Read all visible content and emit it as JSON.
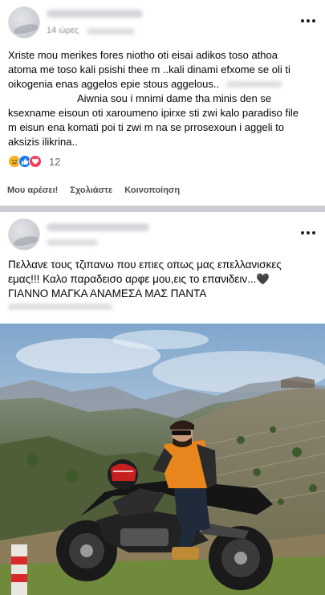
{
  "post1": {
    "time_text": "14 ώρες",
    "body_lines": [
      "Xriste mou merikes fores niotho oti eisai adikos toso athoa",
      "atoma me toso kali psishi thee m ..kali dinami efxome se oli ti",
      "oikogenia enas aggelos epie stous aggelous..",
      "Aiwnia sou i mnimi dame tha minis den se",
      "ksexname eisoun oti xaroumeno ipirxe sti zwi kalo paradiso file",
      "m eisun ena komati poi ti zwi m na se prrosexoun i aggeli to",
      "aksizis ilikrina.."
    ],
    "reaction_count": "12",
    "reactions": [
      "sad",
      "like",
      "love"
    ],
    "actions": {
      "like": "Μου αρέσει!",
      "comment": "Σχολιάστε",
      "share": "Κοινοποίηση"
    }
  },
  "post2": {
    "body_lines": [
      "Πελλανε τους τζιπανω που επιες οπως μας επελλανισκες",
      "εμας!!! Καλο παραδεισο αρφε μου,εις το επανιδειν...🖤",
      "ΓΙΑΝΝΟ ΜΑΓΚΑ ΑΝΑΜΕΣΑ ΜΑΣ ΠΑΝΤΑ"
    ]
  },
  "colors": {
    "separator": "#c9ccd1",
    "secondary_text": "#65676b",
    "like_blue": "#1877f2",
    "love_red": "#f33e58",
    "sad_yellow": "#f7b125",
    "sky_top": "#7fa6cc",
    "jacket_orange": "#e8851d"
  },
  "icons": {
    "more": "more-options-icon",
    "reaction_sad": "sad-reaction-icon",
    "reaction_like": "like-reaction-icon",
    "reaction_love": "love-reaction-icon",
    "heart": "black-heart-emoji"
  }
}
